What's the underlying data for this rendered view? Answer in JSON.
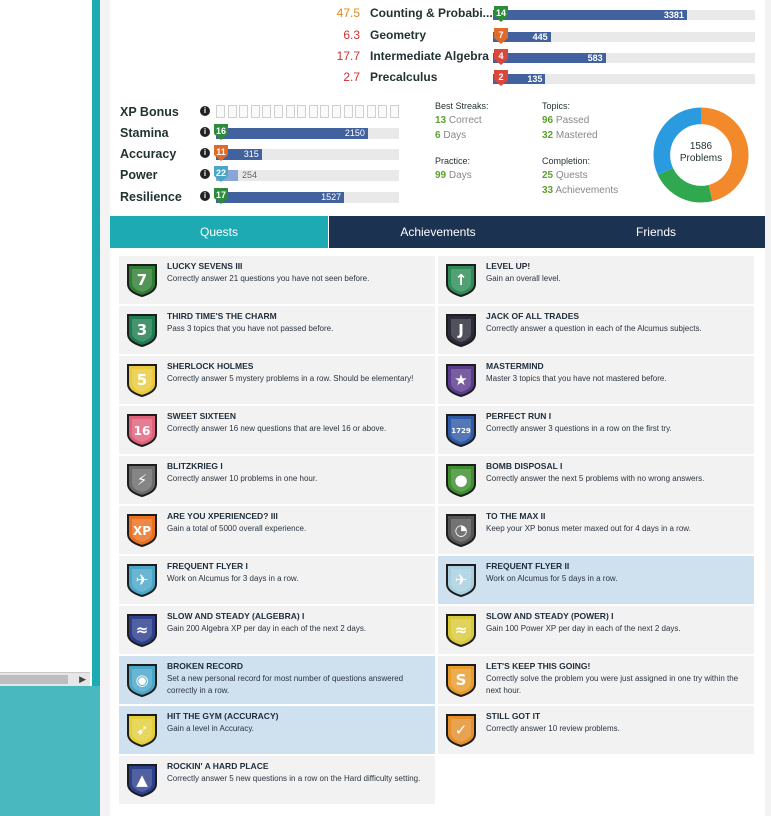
{
  "subjects": [
    {
      "value": "47.5",
      "value_color": "#e08a1a",
      "name": "Counting & Probabi...",
      "level": "14",
      "shield_color": "#2e8b3c",
      "xp": "3381",
      "pct": 0.74
    },
    {
      "value": "6.3",
      "value_color": "#d32f2f",
      "name": "Geometry",
      "level": "7",
      "shield_color": "#e06a2a",
      "xp": "445",
      "pct": 0.22
    },
    {
      "value": "17.7",
      "value_color": "#d32f2f",
      "name": "Intermediate Algebra",
      "level": "4",
      "shield_color": "#d9483b",
      "xp": "583",
      "pct": 0.43
    },
    {
      "value": "2.7",
      "value_color": "#d32f2f",
      "name": "Precalculus",
      "level": "2",
      "shield_color": "#d9483b",
      "xp": "135",
      "pct": 0.2
    }
  ],
  "stats": {
    "xp_bonus": {
      "label": "XP Bonus",
      "segments": 16
    },
    "stamina": {
      "label": "Stamina",
      "level": "16",
      "value": "2150",
      "pct": 0.83
    },
    "accuracy": {
      "label": "Accuracy",
      "level": "11",
      "value": "315",
      "pct": 0.25
    },
    "power": {
      "label": "Power",
      "level": "22",
      "value": "254",
      "pct": 0.12
    },
    "resilience": {
      "label": "Resilience",
      "level": "17",
      "value": "1527",
      "pct": 0.7
    }
  },
  "summary": {
    "best_streaks_label": "Best Streaks:",
    "streak_correct_num": "13",
    "streak_correct_txt": "Correct",
    "streak_days_num": "6",
    "streak_days_txt": "Days",
    "practice_label": "Practice:",
    "practice_num": "99",
    "practice_txt": "Days",
    "topics_label": "Topics:",
    "topics_passed_num": "96",
    "topics_passed_txt": "Passed",
    "topics_mastered_num": "32",
    "topics_mastered_txt": "Mastered",
    "completion_label": "Completion:",
    "quests_num": "25",
    "quests_txt": "Quests",
    "achievements_num": "33",
    "achievements_txt": "Achievements"
  },
  "donut": {
    "count": "1586",
    "label": "Problems",
    "segments": [
      {
        "color": "#f28a2b",
        "value": 0.46
      },
      {
        "color": "#2fa84f",
        "value": 0.22
      },
      {
        "color": "#2b9be0",
        "value": 0.32
      }
    ]
  },
  "tabs": {
    "quests": "Quests",
    "achievements": "Achievements",
    "friends": "Friends"
  },
  "quests": [
    {
      "title": "LUCKY SEVENS III",
      "desc": "Correctly answer 21 questions you have not seen before.",
      "icon": "lucky-seven-badge-icon",
      "color": "#2e7d32",
      "glyph": "7",
      "highlight": false
    },
    {
      "title": "LEVEL UP!",
      "desc": "Gain an overall level.",
      "icon": "level-up-badge-icon",
      "color": "#2e8b57",
      "glyph": "↑",
      "highlight": false
    },
    {
      "title": "THIRD TIME'S THE CHARM",
      "desc": "Pass 3 topics that you have not passed before.",
      "icon": "clover-badge-icon",
      "color": "#1e7a4f",
      "glyph": "3",
      "highlight": false
    },
    {
      "title": "JACK OF ALL TRADES",
      "desc": "Correctly answer a question in each of the Alcumus subjects.",
      "icon": "jack-card-badge-icon",
      "color": "#2b2b3a",
      "glyph": "J",
      "highlight": false
    },
    {
      "title": "SHERLOCK HOLMES",
      "desc": "Correctly answer 5 mystery problems in a row. Should be elementary!",
      "icon": "magnifier-badge-icon",
      "color": "#e9c93b",
      "glyph": "5",
      "highlight": false
    },
    {
      "title": "MASTERMIND",
      "desc": "Master 3 topics that you have not mastered before.",
      "icon": "mortarboard-badge-icon",
      "color": "#5b3b8c",
      "glyph": "★",
      "highlight": false
    },
    {
      "title": "SWEET SIXTEEN",
      "desc": "Correctly answer 16 new questions that are level 16 or above.",
      "icon": "sweet-sixteen-badge-icon",
      "color": "#e0627a",
      "glyph": "16",
      "highlight": false
    },
    {
      "title": "PERFECT RUN I",
      "desc": "Correctly answer 3 questions in a row on the first try.",
      "icon": "perfect-run-badge-icon",
      "color": "#2f5aa8",
      "glyph": "1729",
      "highlight": false
    },
    {
      "title": "BLITZKRIEG I",
      "desc": "Correctly answer 10 problems in one hour.",
      "icon": "blitzkrieg-badge-icon",
      "color": "#6b6b6b",
      "glyph": "⚡",
      "highlight": false
    },
    {
      "title": "BOMB DISPOSAL I",
      "desc": "Correctly answer the next 5 problems with no wrong answers.",
      "icon": "bomb-badge-icon",
      "color": "#3e8e2e",
      "glyph": "●",
      "highlight": false
    },
    {
      "title": "ARE YOU XPERIENCED? III",
      "desc": "Gain a total of 5000 overall experience.",
      "icon": "xp-badge-icon",
      "color": "#e8701e",
      "glyph": "XP",
      "highlight": false
    },
    {
      "title": "TO THE MAX II",
      "desc": "Keep your XP bonus meter maxed out for 4 days in a row.",
      "icon": "gauge-badge-icon",
      "color": "#555555",
      "glyph": "◔",
      "highlight": false
    },
    {
      "title": "FREQUENT FLYER I",
      "desc": "Work on Alcumus for 3 days in a row.",
      "icon": "airplane-badge-icon",
      "color": "#4aa6c8",
      "glyph": "✈",
      "highlight": false
    },
    {
      "title": "FREQUENT FLYER II",
      "desc": "Work on Alcumus for 5 days in a row.",
      "icon": "airplane-faded-badge-icon",
      "color": "#a8cfe0",
      "glyph": "✈",
      "highlight": true
    },
    {
      "title": "SLOW AND STEADY (ALGEBRA) I",
      "desc": "Gain 200 Algebra XP per day in each of the next 2 days.",
      "icon": "turtle-badge-icon",
      "color": "#2c3e8c",
      "glyph": "≈",
      "highlight": false
    },
    {
      "title": "SLOW AND STEADY (POWER) I",
      "desc": "Gain 100 Power XP per day in each of the next 2 days.",
      "icon": "weight-turtle-badge-icon",
      "color": "#d8c93a",
      "glyph": "≈",
      "highlight": false
    },
    {
      "title": "BROKEN RECORD",
      "desc": "Set a new personal record for most number of questions answered correctly in a row.",
      "icon": "record-badge-icon",
      "color": "#4aa6c8",
      "glyph": "◉",
      "highlight": true
    },
    {
      "title": "LET'S KEEP THIS GOING!",
      "desc": "Correctly solve the problem you were just assigned in one try within the next hour.",
      "icon": "snake-badge-icon",
      "color": "#e89a2a",
      "glyph": "S",
      "highlight": false
    },
    {
      "title": "HIT THE GYM (ACCURACY)",
      "desc": "Gain a level in Accuracy.",
      "icon": "archer-badge-icon",
      "color": "#e3cf3a",
      "glyph": "➶",
      "highlight": true
    },
    {
      "title": "STILL GOT IT",
      "desc": "Correctly answer 10 review problems.",
      "icon": "still-got-it-badge-icon",
      "color": "#e58e2a",
      "glyph": "✓",
      "highlight": false
    },
    {
      "title": "ROCKIN' A HARD PLACE",
      "desc": "Correctly answer 5 new questions in a row on the Hard difficulty setting.",
      "icon": "climber-badge-icon",
      "color": "#2b3f8c",
      "glyph": "▲",
      "highlight": false
    }
  ]
}
